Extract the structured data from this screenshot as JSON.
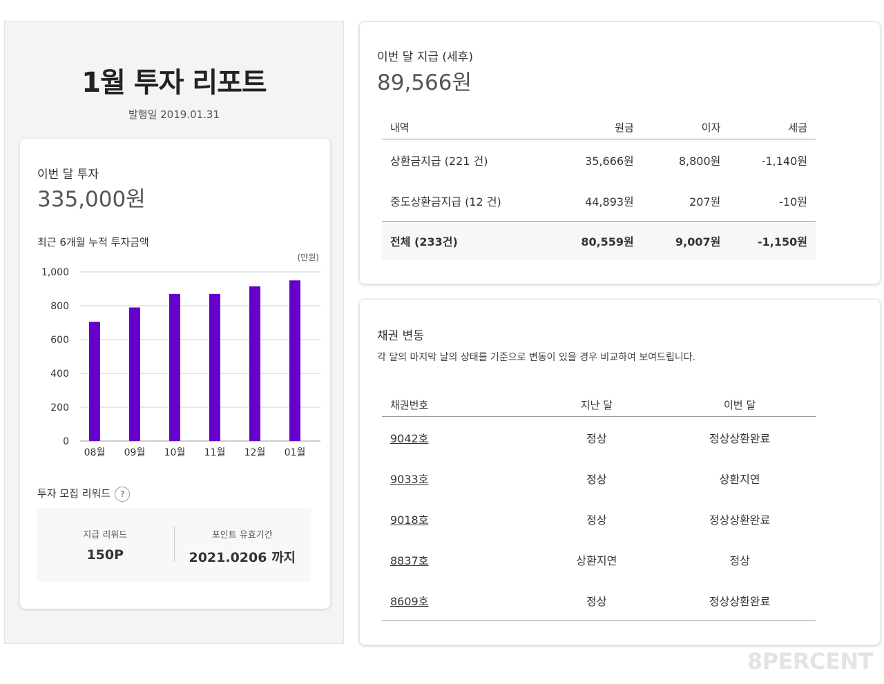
{
  "report": {
    "title": "1월 투자 리포트",
    "issue_date": "발행일 2019.01.31"
  },
  "invest": {
    "label": "이번 달 투자",
    "amount": "335,000원",
    "chart_title": "최근 6개월 누적 투자금액",
    "unit": "(만원)"
  },
  "chart_data": {
    "type": "bar",
    "title": "최근 6개월 누적 투자금액",
    "ylabel": "(만원)",
    "categories": [
      "08월",
      "09월",
      "10월",
      "11월",
      "12월",
      "01월"
    ],
    "values": [
      705,
      790,
      870,
      870,
      915,
      950
    ],
    "ylim": [
      0,
      1000
    ],
    "yticks": [
      "0",
      "200",
      "400",
      "600",
      "800",
      "1,000"
    ],
    "grid": true,
    "bar_color": "#6600cc"
  },
  "reward": {
    "title": "투자 모집 리워드",
    "help_glyph": "?",
    "paid_label": "지급 리워드",
    "paid_value": "150P",
    "expiry_label": "포인트 유효기간",
    "expiry_value": "2021.0206 까지"
  },
  "payout": {
    "label": "이번 달 지급 (세후)",
    "amount": "89,566원",
    "headers": [
      "내역",
      "원금",
      "이자",
      "세금"
    ],
    "rows": [
      [
        "상환금지급 (221 건)",
        "35,666원",
        "8,800원",
        "-1,140원"
      ],
      [
        "중도상환금지급 (12 건)",
        "44,893원",
        "207원",
        "-10원"
      ]
    ],
    "total": [
      "전체 (233건)",
      "80,559원",
      "9,007원",
      "-1,150원"
    ]
  },
  "bond": {
    "title": "채권 변동",
    "description": "각 달의 마지막 날의 상태를 기준으로 변동이 있을 경우 비교하여 보여드립니다.",
    "headers": [
      "채권번호",
      "지난 달",
      "이번 달"
    ],
    "rows": [
      [
        "9042호",
        "정상",
        "정상상환완료"
      ],
      [
        "9033호",
        "정상",
        "상환지연"
      ],
      [
        "9018호",
        "정상",
        "정상상환완료"
      ],
      [
        "8837호",
        "상환지연",
        "정상"
      ],
      [
        "8609호",
        "정상",
        "정상상환완료"
      ]
    ]
  },
  "brand": "8PERCENT"
}
